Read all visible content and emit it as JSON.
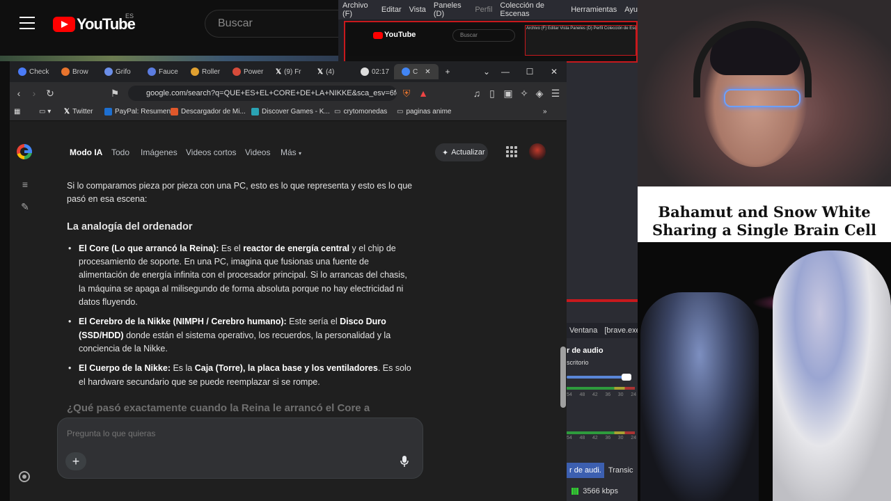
{
  "youtube": {
    "logo_text": "YouTube",
    "region": "ES",
    "search_placeholder": "Buscar"
  },
  "obs": {
    "menu": [
      "Archivo (F)",
      "Editar",
      "Vista",
      "Paneles (D)",
      "Perfil",
      "Colección de Escenas",
      "Herramientas",
      "Ayu"
    ],
    "preview_logo": "YouTube",
    "preview_search": "Buscar",
    "preview_nested_menu": "Archivo (F)  Editar  Vista  Paneles (D)  Perfil  Colección de Esc",
    "update_label": "Actualizar",
    "source_tab_1": "Ventana",
    "source_tab_2": "[brave.exe",
    "audio_title": "r de audio",
    "audio_device": "scritorio",
    "meter_ticks": [
      "54",
      "48",
      "42",
      "36",
      "30",
      "24"
    ],
    "tab_audio": "r de audi.",
    "tab_transitions": "Transic",
    "bitrate": "3566 kbps"
  },
  "clip": {
    "title_line1": "Bahamut and Snow White",
    "title_line2": "Sharing a Single Brain Cell"
  },
  "browser": {
    "tabs": [
      {
        "label": "Check",
        "color": "#4a7bf7"
      },
      {
        "label": "Brow",
        "color": "#e8742d"
      },
      {
        "label": "Grifo",
        "color": "#6b8ee8"
      },
      {
        "label": "Fauce",
        "color": "#5b7ce0"
      },
      {
        "label": "Roller",
        "color": "#e0a030"
      },
      {
        "label": "Power",
        "color": "#d64b3a"
      },
      {
        "label": "(9) Fr",
        "color": "#ffffff"
      },
      {
        "label": "(4)",
        "color": "#ffffff"
      },
      {
        "label": "02:17",
        "color": "#dddddd"
      },
      {
        "label": "C",
        "color": "#4285f4"
      }
    ],
    "url": "google.com/search?q=QUE+ES+EL+CORE+DE+LA+NIKKE&sca_esv=6fc...",
    "bookmarks": [
      {
        "label": "Twitter",
        "color": "#ffffff"
      },
      {
        "label": "PayPal: Resumen",
        "color": "#1d6fd1"
      },
      {
        "label": "Descargador de Mi...",
        "color": "#e0582b"
      },
      {
        "label": "Discover Games - K...",
        "color": "#2aa3b4"
      },
      {
        "label": "crytomonedas",
        "color": ""
      },
      {
        "label": "paginas anime",
        "color": ""
      }
    ]
  },
  "google": {
    "tabs": [
      "Modo IA",
      "Todo",
      "Imágenes",
      "Videos cortos",
      "Videos",
      "Más"
    ],
    "update_button": "Actualizar",
    "intro": "Si lo comparamos pieza por pieza con una PC, esto es lo que representa y esto es lo que pasó en esa escena:",
    "heading": "La analogía del ordenador",
    "bullets": [
      {
        "b1": "El Core (Lo que arrancó la Reina):",
        "t1": " Es el ",
        "b2": "reactor de energía central",
        "t2": " y el chip de procesamiento de soporte. En una PC, imagina que fusionas una fuente de alimentación de energía infinita con el procesador principal. Si lo arrancas del chasis, la máquina se apaga al milisegundo de forma absoluta porque no hay electricidad ni datos fluyendo."
      },
      {
        "b1": "El Cerebro de la Nikke (NIMPH / Cerebro humano):",
        "t1": " Este sería el ",
        "b2": "Disco Duro (SSD/HDD)",
        "t2": " donde están el sistema operativo, los recuerdos, la personalidad y la conciencia de la Nikke."
      },
      {
        "b1": "El Cuerpo de la Nikke:",
        "t1": " Es la ",
        "b2": "Caja (Torre), la placa base y los ventiladores",
        "t2": ". Es solo el hardware secundario que se puede reemplazar si se rompe."
      }
    ],
    "next_heading": "¿Qué pasó exactamente cuando la Reina le arrancó el Core a",
    "ask_placeholder": "Pregunta lo que quieras"
  }
}
